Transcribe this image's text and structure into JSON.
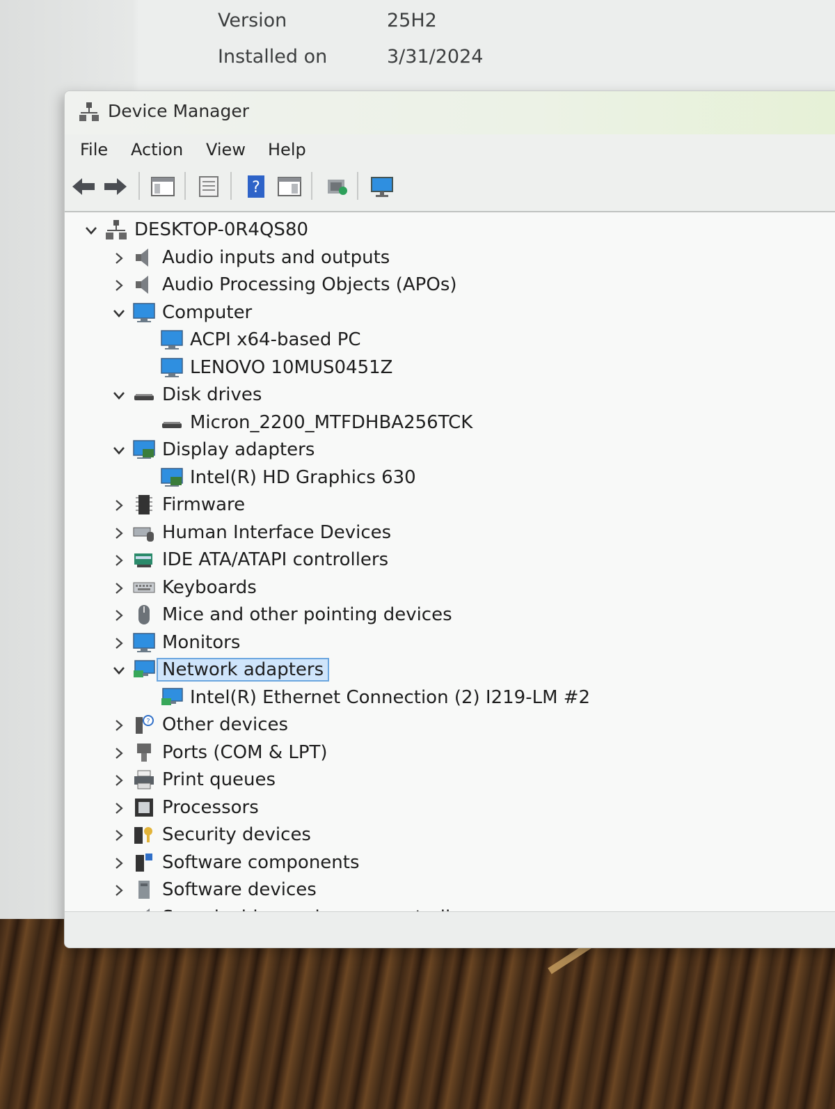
{
  "background_settings": {
    "rows": [
      {
        "label": "Version",
        "value": "25H2"
      },
      {
        "label": "Installed on",
        "value": "3/31/2024"
      }
    ]
  },
  "window": {
    "title": "Device Manager",
    "menu": [
      "File",
      "Action",
      "View",
      "Help"
    ],
    "toolbar_icons": [
      "back-icon",
      "forward-icon",
      "show-hide-console-tree-icon",
      "properties-icon",
      "help-icon",
      "view-icon",
      "update-driver-icon",
      "scan-hardware-icon"
    ]
  },
  "tree": {
    "root": "DESKTOP-0R4QS80",
    "items": [
      {
        "label": "Audio inputs and outputs",
        "expanded": false
      },
      {
        "label": "Audio Processing Objects (APOs)",
        "expanded": false
      },
      {
        "label": "Computer",
        "expanded": true,
        "children": [
          "ACPI x64-based PC",
          "LENOVO 10MUS0451Z"
        ]
      },
      {
        "label": "Disk drives",
        "expanded": true,
        "children": [
          "Micron_2200_MTFDHBA256TCK"
        ]
      },
      {
        "label": "Display adapters",
        "expanded": true,
        "children": [
          "Intel(R) HD Graphics 630"
        ]
      },
      {
        "label": "Firmware",
        "expanded": false
      },
      {
        "label": "Human Interface Devices",
        "expanded": false
      },
      {
        "label": "IDE ATA/ATAPI controllers",
        "expanded": false
      },
      {
        "label": "Keyboards",
        "expanded": false
      },
      {
        "label": "Mice and other pointing devices",
        "expanded": false
      },
      {
        "label": "Monitors",
        "expanded": false
      },
      {
        "label": "Network adapters",
        "expanded": true,
        "selected": true,
        "children": [
          "Intel(R) Ethernet Connection (2) I219-LM #2"
        ]
      },
      {
        "label": "Other devices",
        "expanded": false
      },
      {
        "label": "Ports (COM & LPT)",
        "expanded": false
      },
      {
        "label": "Print queues",
        "expanded": false
      },
      {
        "label": "Processors",
        "expanded": false
      },
      {
        "label": "Security devices",
        "expanded": false
      },
      {
        "label": "Software components",
        "expanded": false
      },
      {
        "label": "Software devices",
        "expanded": false
      },
      {
        "label": "Sound, video and game controllers",
        "expanded": false
      }
    ]
  },
  "colors": {
    "selection_bg": "#cfe5fb",
    "selection_border": "#6ba6df",
    "monitor_blue": "#2f8fe0"
  }
}
